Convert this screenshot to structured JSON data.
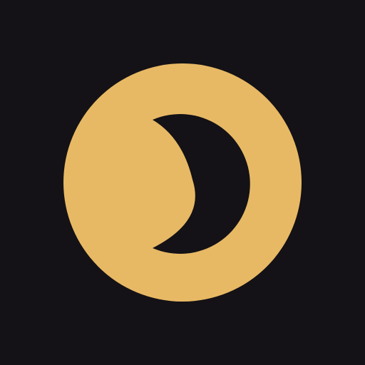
{
  "app_icon": {
    "name": "crescent-moon-app-icon",
    "colors": {
      "background": "#141216",
      "circle": "#E8B964",
      "moon": "#141216"
    }
  }
}
